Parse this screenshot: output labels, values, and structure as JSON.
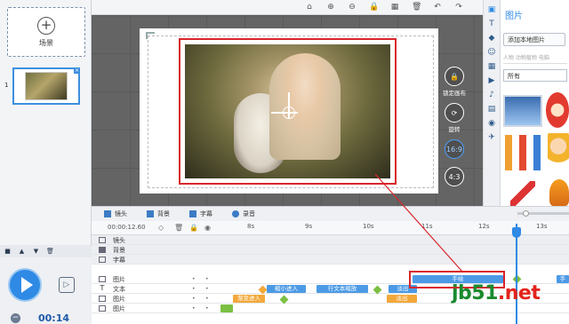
{
  "left_panel": {
    "add_scene_label": "场景",
    "scene_number": "1"
  },
  "player": {
    "time": "00:14"
  },
  "canvas": {
    "controls": [
      {
        "label": "锁定画布",
        "symbol": "🔒"
      },
      {
        "label": "旋转",
        "symbol": "⟳"
      },
      {
        "label": "",
        "symbol": "16:9"
      },
      {
        "label": "",
        "symbol": "4:3"
      }
    ]
  },
  "right_panel": {
    "title": "图片",
    "add_image_button": "添加本地图片",
    "search_placeholder": "人物 动物植物 电脑",
    "filter_value": "所有"
  },
  "timeline": {
    "tabs": [
      "镜头",
      "背景",
      "字幕",
      "录音"
    ],
    "current_time": "00:00:12.60",
    "ticks": [
      "8s",
      "9s",
      "10s",
      "11s",
      "12s",
      "13s"
    ],
    "tracks": [
      {
        "label": "镜头",
        "icon": "camera-icon"
      },
      {
        "label": "背景",
        "icon": "background-icon"
      },
      {
        "label": "字幕",
        "icon": "subtitle-icon"
      },
      {
        "label": "图片",
        "icon": "image-icon"
      },
      {
        "label": "文本",
        "icon": "text-icon"
      },
      {
        "label": "图片",
        "icon": "image-icon"
      },
      {
        "label": "图片",
        "icon": "image-icon"
      }
    ],
    "clips": {
      "image1": [
        "手绘",
        "手"
      ],
      "text": [
        "缩小进入",
        "行文本缩放",
        "淡出"
      ],
      "image2": [
        "渐变进入",
        "淡出"
      ]
    }
  },
  "watermark": {
    "green": "jb51",
    "red": ".net"
  }
}
